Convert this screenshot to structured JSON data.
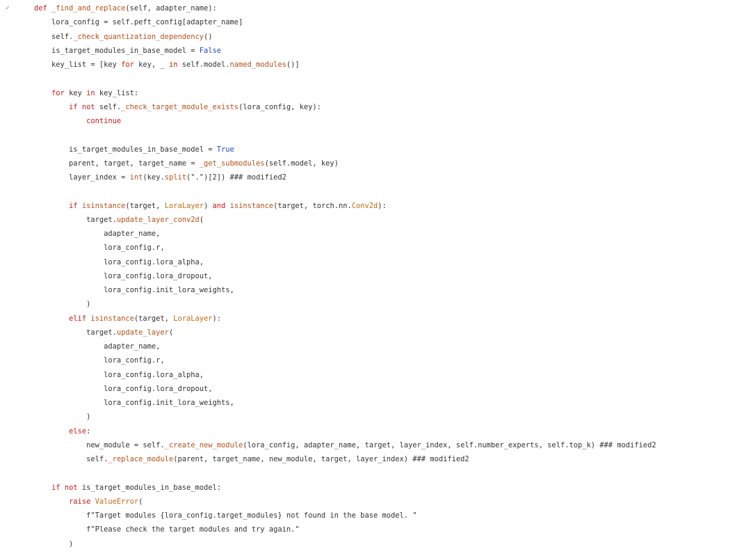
{
  "editor": {
    "fold_icon": "chevron-icon",
    "lines": [
      [
        [
          "kw",
          "def "
        ],
        [
          "fn",
          "_find_and_replace"
        ],
        [
          "pl",
          "(self, adapter_name):"
        ]
      ],
      [
        [
          "pl",
          "    lora_config = self.peft_config[adapter_name]"
        ]
      ],
      [
        [
          "pl",
          "    self."
        ],
        [
          "fn",
          "_check_quantization_dependency"
        ],
        [
          "pl",
          "()"
        ]
      ],
      [
        [
          "pl",
          "    is_target_modules_in_base_model = "
        ],
        [
          "kb",
          "False"
        ]
      ],
      [
        [
          "pl",
          "    key_list = [key "
        ],
        [
          "kw",
          "for"
        ],
        [
          "pl",
          " key, _ "
        ],
        [
          "kw",
          "in"
        ],
        [
          "pl",
          " self.model."
        ],
        [
          "fn",
          "named_modules"
        ],
        [
          "pl",
          "()]"
        ]
      ],
      [],
      [
        [
          "pl",
          "    "
        ],
        [
          "kw",
          "for"
        ],
        [
          "pl",
          " key "
        ],
        [
          "kw",
          "in"
        ],
        [
          "pl",
          " key_list:"
        ]
      ],
      [
        [
          "pl",
          "        "
        ],
        [
          "kw",
          "if"
        ],
        [
          "pl",
          " "
        ],
        [
          "kw",
          "not"
        ],
        [
          "pl",
          " self."
        ],
        [
          "fn",
          "_check_target_module_exists"
        ],
        [
          "pl",
          "(lora_config, key):"
        ]
      ],
      [
        [
          "pl",
          "            "
        ],
        [
          "kw",
          "continue"
        ]
      ],
      [],
      [
        [
          "pl",
          "        is_target_modules_in_base_model = "
        ],
        [
          "kb",
          "True"
        ]
      ],
      [
        [
          "pl",
          "        parent, target, target_name = "
        ],
        [
          "fn",
          "_get_submodules"
        ],
        [
          "pl",
          "(self.model, key)"
        ]
      ],
      [
        [
          "pl",
          "        layer_index = "
        ],
        [
          "fn",
          "int"
        ],
        [
          "pl",
          "(key."
        ],
        [
          "fn",
          "split"
        ],
        [
          "str",
          "(\".\")"
        ],
        [
          "pl",
          "[2]) "
        ],
        [
          "cm",
          "### modified2"
        ]
      ],
      [],
      [
        [
          "pl",
          "        "
        ],
        [
          "kw",
          "if"
        ],
        [
          "pl",
          " "
        ],
        [
          "fn",
          "isinstance"
        ],
        [
          "pl",
          "(target, "
        ],
        [
          "cls",
          "LoraLayer"
        ],
        [
          "pl",
          ") "
        ],
        [
          "kw",
          "and"
        ],
        [
          "pl",
          " "
        ],
        [
          "fn",
          "isinstance"
        ],
        [
          "pl",
          "(target, torch.nn."
        ],
        [
          "cls",
          "Conv2d"
        ],
        [
          "pl",
          "):"
        ]
      ],
      [
        [
          "pl",
          "            target."
        ],
        [
          "fn",
          "update_layer_conv2d"
        ],
        [
          "pl",
          "("
        ]
      ],
      [
        [
          "pl",
          "                adapter_name,"
        ]
      ],
      [
        [
          "pl",
          "                lora_config.r,"
        ]
      ],
      [
        [
          "pl",
          "                lora_config.lora_alpha,"
        ]
      ],
      [
        [
          "pl",
          "                lora_config.lora_dropout,"
        ]
      ],
      [
        [
          "pl",
          "                lora_config.init_lora_weights,"
        ]
      ],
      [
        [
          "pl",
          "            )"
        ]
      ],
      [
        [
          "pl",
          "        "
        ],
        [
          "kw",
          "elif"
        ],
        [
          "pl",
          " "
        ],
        [
          "fn",
          "isinstance"
        ],
        [
          "pl",
          "(target, "
        ],
        [
          "cls",
          "LoraLayer"
        ],
        [
          "pl",
          "):"
        ]
      ],
      [
        [
          "pl",
          "            target."
        ],
        [
          "fn",
          "update_layer"
        ],
        [
          "pl",
          "("
        ]
      ],
      [
        [
          "pl",
          "                adapter_name,"
        ]
      ],
      [
        [
          "pl",
          "                lora_config.r,"
        ]
      ],
      [
        [
          "pl",
          "                lora_config.lora_alpha,"
        ]
      ],
      [
        [
          "pl",
          "                lora_config.lora_dropout,"
        ]
      ],
      [
        [
          "pl",
          "                lora_config.init_lora_weights,"
        ]
      ],
      [
        [
          "pl",
          "            )"
        ]
      ],
      [
        [
          "pl",
          "        "
        ],
        [
          "kw",
          "else"
        ],
        [
          "pl",
          ":"
        ]
      ],
      [
        [
          "pl",
          "            new_module = self."
        ],
        [
          "fn",
          "_create_new_module"
        ],
        [
          "pl",
          "(lora_config, adapter_name, target, layer_index, self.number_experts, self.top_k) "
        ],
        [
          "cm",
          "### modified2"
        ]
      ],
      [
        [
          "pl",
          "            self."
        ],
        [
          "fn",
          "_replace_module"
        ],
        [
          "pl",
          "(parent, target_name, new_module, target, layer_index) "
        ],
        [
          "cm",
          "### modified2"
        ]
      ],
      [],
      [
        [
          "pl",
          "    "
        ],
        [
          "kw",
          "if"
        ],
        [
          "pl",
          " "
        ],
        [
          "kw",
          "not"
        ],
        [
          "pl",
          " is_target_modules_in_base_model:"
        ]
      ],
      [
        [
          "pl",
          "        "
        ],
        [
          "kw",
          "raise"
        ],
        [
          "pl",
          " "
        ],
        [
          "cls",
          "ValueError"
        ],
        [
          "pl",
          "("
        ]
      ],
      [
        [
          "pl",
          "            "
        ],
        [
          "str",
          "f\"Target modules {lora_config.target_modules} not found in the base model. \""
        ]
      ],
      [
        [
          "pl",
          "            "
        ],
        [
          "str",
          "f\"Please check the target modules and try again.\""
        ]
      ],
      [
        [
          "pl",
          "        )"
        ]
      ]
    ]
  }
}
